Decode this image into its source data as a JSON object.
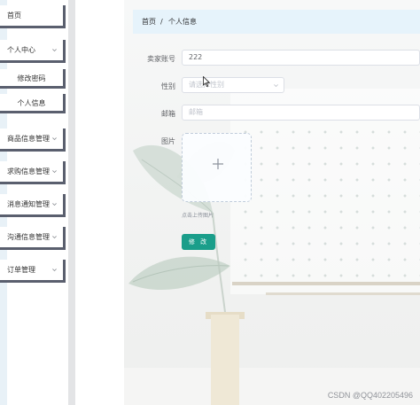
{
  "sidebar": {
    "home": "首页",
    "personal_center": "个人中心",
    "change_password": "修改密码",
    "personal_info": "个人信息",
    "product_info_mgmt": "商品信息管理",
    "purchase_info_mgmt": "求购信息管理",
    "message_notice_mgmt": "消息通知管理",
    "communication_info_mgmt": "沟通信息管理",
    "order_mgmt": "订单管理"
  },
  "breadcrumb": {
    "home": "首页",
    "separator": "/",
    "current": "个人信息"
  },
  "form": {
    "seller_account_label": "卖家账号",
    "seller_account_value": "222",
    "gender_label": "性别",
    "gender_placeholder": "请选择性别",
    "email_label": "邮箱",
    "email_placeholder": "邮箱",
    "image_label": "图片",
    "upload_tip": "点击上传图片",
    "edit_button": "修 改"
  },
  "watermark": "CSDN @QQ402205496",
  "icons": {
    "chevron": "chevron-down-icon",
    "plus": "plus-icon",
    "cursor": "cursor-icon"
  },
  "colors": {
    "accent": "#1a9e8a",
    "breadcrumb_bg": "#e6f3fb",
    "sidebar_border": "#5a5f6e"
  }
}
